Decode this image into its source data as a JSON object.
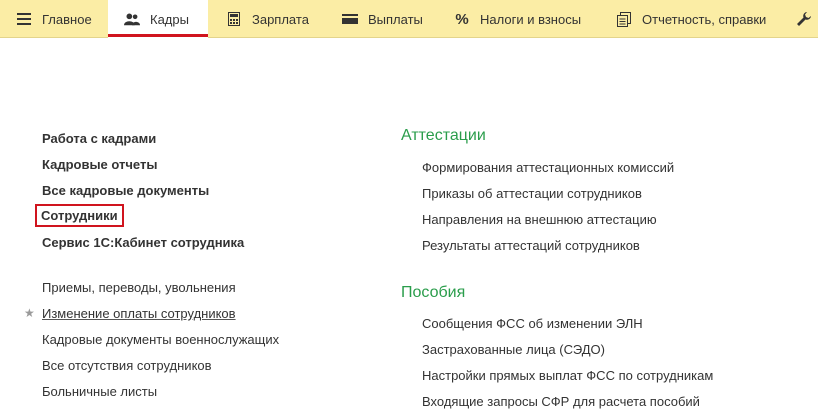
{
  "tabs": [
    {
      "label": "Главное",
      "icon": "menu-icon"
    },
    {
      "label": "Кадры",
      "icon": "people-icon"
    },
    {
      "label": "Зарплата",
      "icon": "calculator-icon"
    },
    {
      "label": "Выплаты",
      "icon": "wallet-icon"
    },
    {
      "label": "Налоги и взносы",
      "icon": "percent-icon"
    },
    {
      "label": "Отчетность, справки",
      "icon": "reports-icon"
    },
    {
      "label": "",
      "icon": "wrench-icon"
    }
  ],
  "left": {
    "main_links": [
      "Работа с кадрами",
      "Кадровые отчеты",
      "Все кадровые документы",
      "Сотрудники",
      "Сервис 1С:Кабинет сотрудника"
    ],
    "links": [
      "Приемы, переводы, увольнения",
      "Изменение оплаты сотрудников",
      "Кадровые документы военнослужащих",
      "Все отсутствия сотрудников",
      "Больничные листы"
    ]
  },
  "right": {
    "attest": {
      "title": "Аттестации",
      "items": [
        "Формирования аттестационных комиссий",
        "Приказы об аттестации сотрудников",
        "Направления на внешнюю аттестацию",
        "Результаты аттестаций сотрудников"
      ]
    },
    "benefits": {
      "title": "Пособия",
      "items": [
        "Сообщения ФСС об изменении ЭЛН",
        "Застрахованные лица (СЭДО)",
        "Настройки прямых выплат ФСС по сотрудникам",
        "Входящие запросы СФР для расчета пособий"
      ]
    }
  },
  "colors": {
    "topbar": "#fbeda5",
    "accent": "#d0141e",
    "section_header": "#2a9d4b"
  }
}
